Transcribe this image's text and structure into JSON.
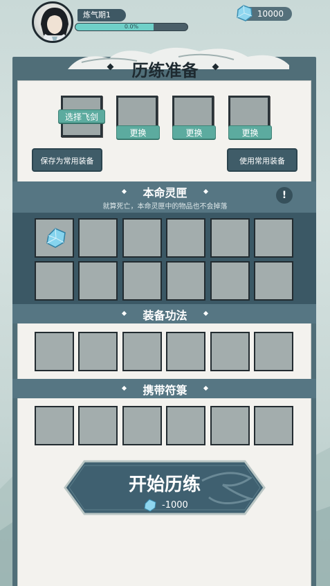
{
  "player": {
    "rank": "炼气期1",
    "exp_percent": 0.7,
    "exp_text": "0.0%"
  },
  "currency": {
    "amount": "10000",
    "icon": "spirit-stone-icon"
  },
  "panel": {
    "title": "历练准备"
  },
  "equipment": {
    "slots": [
      {
        "button": "选择飞剑"
      },
      {
        "button": "更换"
      },
      {
        "button": "更换"
      },
      {
        "button": "更换"
      }
    ],
    "save_label": "保存为常用装备",
    "use_label": "使用常用装备"
  },
  "spirit_box": {
    "title": "本命灵匣",
    "subtitle": "就算死亡，本命灵匣中的物品也不会掉落",
    "info_icon": "!",
    "item_icon": "spirit-stone-icon"
  },
  "techniques": {
    "title": "装备功法"
  },
  "talismans": {
    "title": "携带符箓"
  },
  "start": {
    "label": "开始历练",
    "cost": "-1000"
  },
  "colors": {
    "panel": "#506e78",
    "band": "#567683",
    "accent": "#5cab9f",
    "paper": "#f3f2ee"
  }
}
